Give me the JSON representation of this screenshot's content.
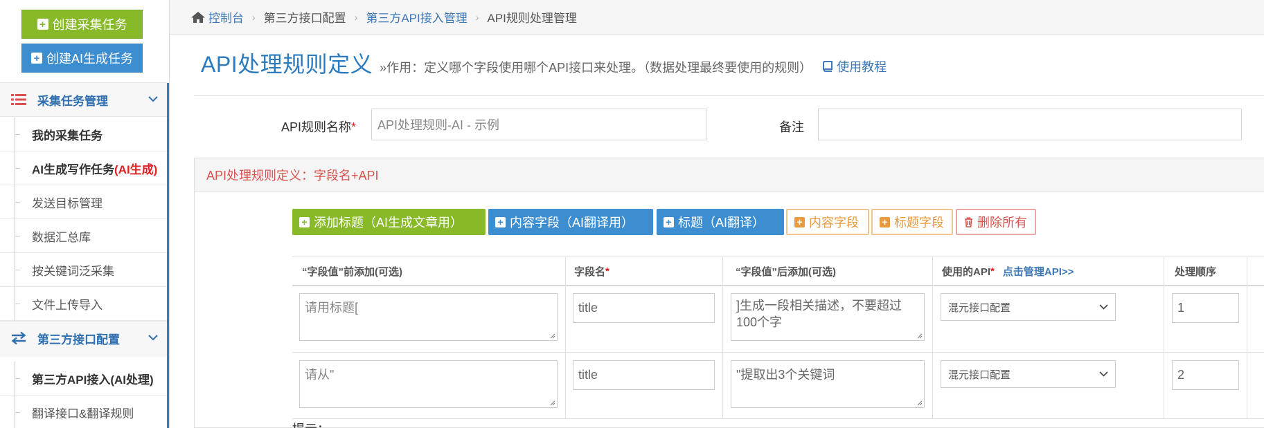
{
  "sidebar": {
    "btn_create_collect": "创建采集任务",
    "btn_create_ai": "创建AI生成任务",
    "sections": [
      {
        "title": "采集任务管理",
        "icon": "list-icon"
      },
      {
        "title": "第三方接口配置",
        "icon": "exchange-icon"
      }
    ],
    "items": [
      {
        "label": "我的采集任务"
      },
      {
        "label": "AI生成写作任务",
        "suffix": "(AI生成)"
      },
      {
        "label": "发送目标管理"
      },
      {
        "label": "数据汇总库"
      },
      {
        "label": "按关键词泛采集"
      },
      {
        "label": "文件上传导入"
      },
      {
        "label": "第三方API接入(AI处理)"
      },
      {
        "label": "翻译接口&翻译规则"
      }
    ]
  },
  "breadcrumb": {
    "home": "控制台",
    "c1": "第三方接口配置",
    "c2": "第三方API接入管理",
    "c3": "API规则处理管理"
  },
  "page": {
    "title": "API处理规则定义",
    "desc": "»作用：定义哪个字段使用哪个API接口来处理。（数据处理最终要使用的规则）",
    "help": "使用教程"
  },
  "form": {
    "name_label": "API规则名称",
    "name_placeholder": "API处理规则-AI - 示例",
    "remark_label": "备注",
    "remark_value": ""
  },
  "panel": {
    "title": "API处理规则定义：字段名+API",
    "buttons": {
      "add_title": "添加标题（AI生成文章用）",
      "content_field_ai": "内容字段（AI翻译用）",
      "title_ai": "标题（AI翻译）",
      "content_field": "内容字段",
      "title_field": "标题字段",
      "delete_all": "删除所有"
    },
    "columns": {
      "prefix": "“字段值”前添加(可选)",
      "field": "字段名",
      "suffix": "“字段值”后添加(可选)",
      "api": "使用的API",
      "api_link": "点击管理API>>",
      "order": "处理顺序"
    },
    "rows": [
      {
        "prefix": "请用标题[",
        "field": "title",
        "suffix": "]生成一段相关描述，不要超过100个字",
        "api": "混元接口配置",
        "order": "1"
      },
      {
        "prefix": "请从\"",
        "field": "title",
        "suffix": "\"提取出3个关键词",
        "api": "混元接口配置",
        "order": "2"
      }
    ],
    "tip": "提示："
  },
  "colors": {
    "accent_blue": "#3d8ed0",
    "accent_green": "#87b928",
    "title_blue": "#2c7bbd",
    "danger": "#d9534f",
    "warning": "#e89a3c"
  }
}
